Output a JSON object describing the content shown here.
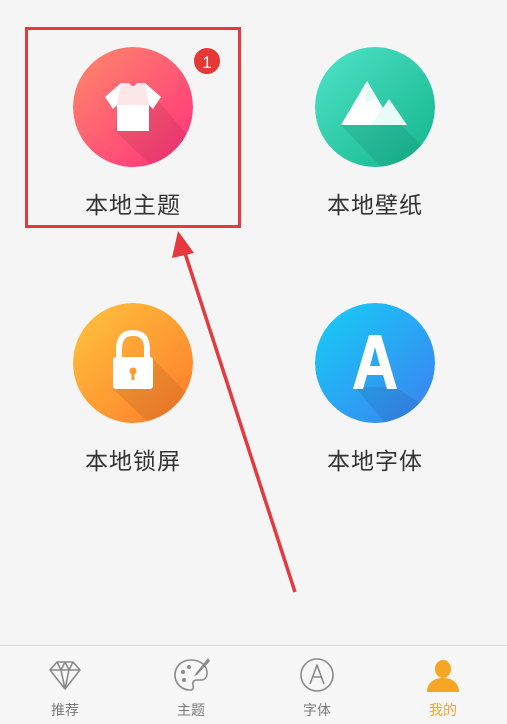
{
  "grid": {
    "items": [
      {
        "label": "本地主题",
        "icon": "tshirt-icon",
        "colors": [
          "#ff7a6e",
          "#ff3d7a"
        ],
        "badge": "1"
      },
      {
        "label": "本地壁纸",
        "icon": "mountain-icon",
        "colors": [
          "#46e0c8",
          "#16b98e"
        ]
      },
      {
        "label": "本地锁屏",
        "icon": "lock-icon",
        "colors": [
          "#ffbf3f",
          "#ff7f2a"
        ]
      },
      {
        "label": "本地字体",
        "icon": "font-a-icon",
        "colors": [
          "#1dc7f5",
          "#3b83f0"
        ]
      }
    ]
  },
  "tabbar": {
    "tabs": [
      {
        "label": "推荐",
        "icon": "diamond-icon"
      },
      {
        "label": "主题",
        "icon": "palette-icon"
      },
      {
        "label": "字体",
        "icon": "font-circle-icon"
      },
      {
        "label": "我的",
        "icon": "user-icon",
        "active": true
      }
    ],
    "active_color": "#f5a623",
    "inactive_color": "#7a7a7a"
  },
  "annotation": {
    "highlight_color": "#e53940"
  }
}
